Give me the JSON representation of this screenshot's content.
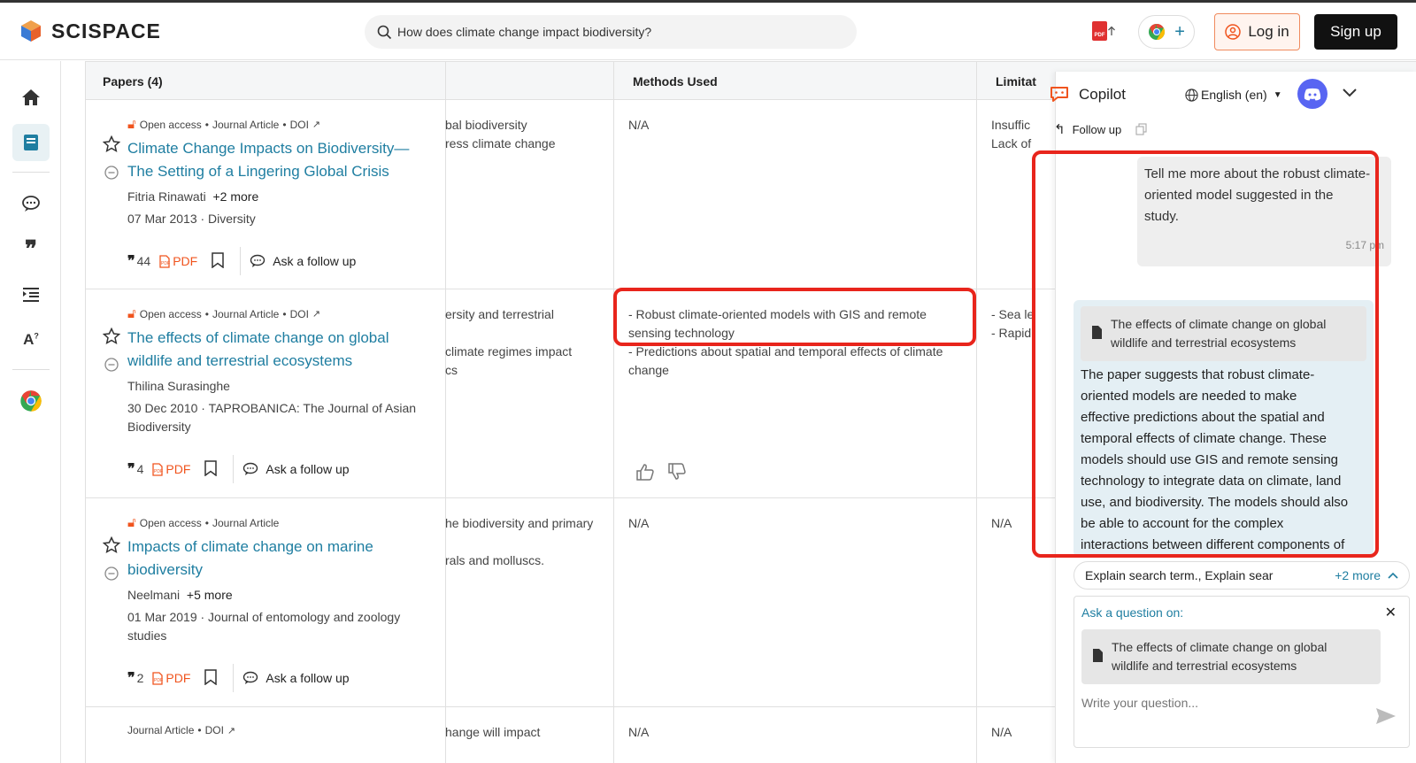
{
  "brand": {
    "name": "SCISPACE"
  },
  "search": {
    "query": "How does climate change impact biodiversity?"
  },
  "header": {
    "pdf_badge": "PDF",
    "login": "Log in",
    "signup": "Sign up"
  },
  "table": {
    "papers_header": "Papers (4)",
    "methods_header": "Methods Used",
    "limitations_header": "Limitat"
  },
  "papers": [
    {
      "access": "Open access",
      "type": "Journal Article",
      "doi": "DOI",
      "title_l1": "Climate Change Impacts on Biodiversity—",
      "title_l2": "The Setting of a Lingering Global Crisis",
      "author": "Fitria Rinawati",
      "more": "+2 more",
      "date_l1": "07 Mar 2013 · Diversity",
      "date_l2": "",
      "citations": "44",
      "pdf": "PDF",
      "ask": "Ask a follow up",
      "col2_l1": "bal biodiversity",
      "col2_l2": "ress climate change",
      "methods_l1": "N/A",
      "methods_l2": "",
      "methods_l3": "",
      "methods_l4": "",
      "limit_l1": "Insuffic",
      "limit_l2": "Lack of"
    },
    {
      "access": "Open access",
      "type": "Journal Article",
      "doi": "DOI",
      "title_l1": "The effects of climate change on global",
      "title_l2": "wildlife and terrestrial ecosystems",
      "author": "Thilina Surasinghe",
      "more": "",
      "date_l1": "30 Dec 2010 · TAPROBANICA: The Journal of Asian",
      "date_l2": "Biodiversity",
      "citations": "4",
      "pdf": "PDF",
      "ask": "Ask a follow up",
      "col2_l1": "ersity and terrestrial",
      "col2_l2": "climate regimes impact",
      "col2_l3": "cs",
      "methods_l1": "- Robust climate-oriented models with GIS and remote",
      "methods_l2": "sensing technology",
      "methods_l3": "- Predictions about spatial and temporal effects of climate",
      "methods_l4": "change",
      "limit_l1": "- Sea le",
      "limit_l2": "- Rapid"
    },
    {
      "access": "Open access",
      "type": "Journal Article",
      "doi": "",
      "title_l1": "Impacts of climate change on marine",
      "title_l2": "biodiversity",
      "author": "Neelmani",
      "more": "+5 more",
      "date_l1": "01 Mar 2019 · Journal of entomology and zoology",
      "date_l2": "studies",
      "citations": "2",
      "pdf": "PDF",
      "ask": "Ask a follow up",
      "col2_l1": "he biodiversity and primary",
      "col2_l2": "rals and molluscs.",
      "methods_l1": "N/A",
      "methods_l2": "",
      "methods_l3": "",
      "methods_l4": "",
      "limit_l1": "N/A",
      "limit_l2": ""
    },
    {
      "access": "",
      "type": "Journal Article",
      "doi": "DOI",
      "col2_l1": "hange will impact",
      "methods_l1": "N/A",
      "limit_l1": "N/A"
    }
  ],
  "copilot": {
    "title": "Copilot",
    "language": "English (en)",
    "follow_up": "Follow up",
    "user_msg_l1": "Tell me more about the robust climate-",
    "user_msg_l2": "oriented model suggested in the",
    "user_msg_l3": "study.",
    "user_time": "5:17 pm",
    "ref_l1": "The effects of climate change on global",
    "ref_l2": "wildlife and terrestrial ecosystems",
    "answer": [
      "The paper suggests that robust climate-",
      "oriented models are needed to make",
      "effective predictions about the spatial and",
      "temporal effects of climate change. These",
      "models should use GIS and remote sensing",
      "technology to integrate data on climate, land",
      "use, and biodiversity. The models should also",
      "be able to account for the complex",
      "interactions between different components of"
    ],
    "chip_text": "Explain search term., Explain sear",
    "chip_more": "+2 more",
    "ask_label": "Ask a question on:",
    "ask_ref_l1": "The effects of climate change on global",
    "ask_ref_l2": "wildlife and terrestrial ecosystems",
    "question_placeholder": "Write your question..."
  },
  "colors": {
    "accent": "#1f7ea1",
    "orange": "#f0541e",
    "highlight": "#e8251c",
    "discord": "#5865f2"
  }
}
